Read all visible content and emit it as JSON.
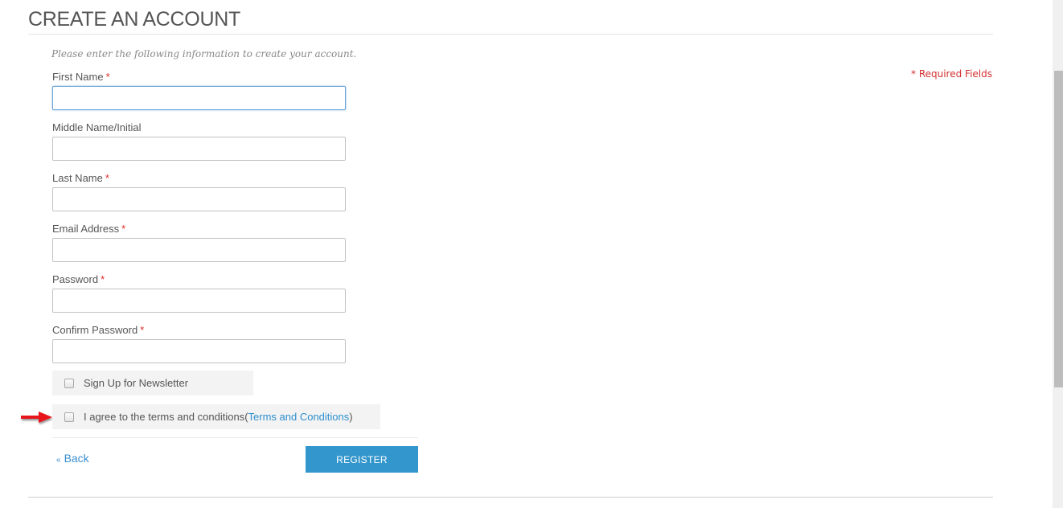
{
  "page": {
    "title": "CREATE AN ACCOUNT",
    "intro": "Please enter the following information to create your account.",
    "required_note": "* Required Fields"
  },
  "form": {
    "fields": [
      {
        "label": "First Name",
        "required": "*",
        "value": "",
        "placeholder": "",
        "type": "text",
        "focused": true
      },
      {
        "label": "Middle Name/Initial",
        "required": "",
        "value": "",
        "placeholder": "",
        "type": "text"
      },
      {
        "label": "Last Name",
        "required": "*",
        "value": "",
        "placeholder": "",
        "type": "text"
      },
      {
        "label": "Email Address",
        "required": "*",
        "value": "",
        "placeholder": "",
        "type": "email"
      },
      {
        "label": "Password",
        "required": "*",
        "value": "",
        "placeholder": "",
        "type": "password"
      },
      {
        "label": "Confirm Password",
        "required": "*",
        "value": "",
        "placeholder": "",
        "type": "password"
      }
    ],
    "newsletter": {
      "label": "Sign Up for Newsletter",
      "checked": false
    },
    "terms": {
      "label": "I agree to the terms and conditions",
      "open_paren": " (",
      "link_text": "Terms and Conditions",
      "close_paren": ")",
      "checked": false
    }
  },
  "actions": {
    "back_prefix": "«",
    "back_label": "Back",
    "register_label": "REGISTER"
  },
  "annotation": {
    "arrow_color": "#e8141c",
    "arrow_icon": "arrow-right-icon"
  },
  "colors": {
    "accent": "#3396cc",
    "link": "#2e8fce",
    "required": "#e02b27"
  }
}
